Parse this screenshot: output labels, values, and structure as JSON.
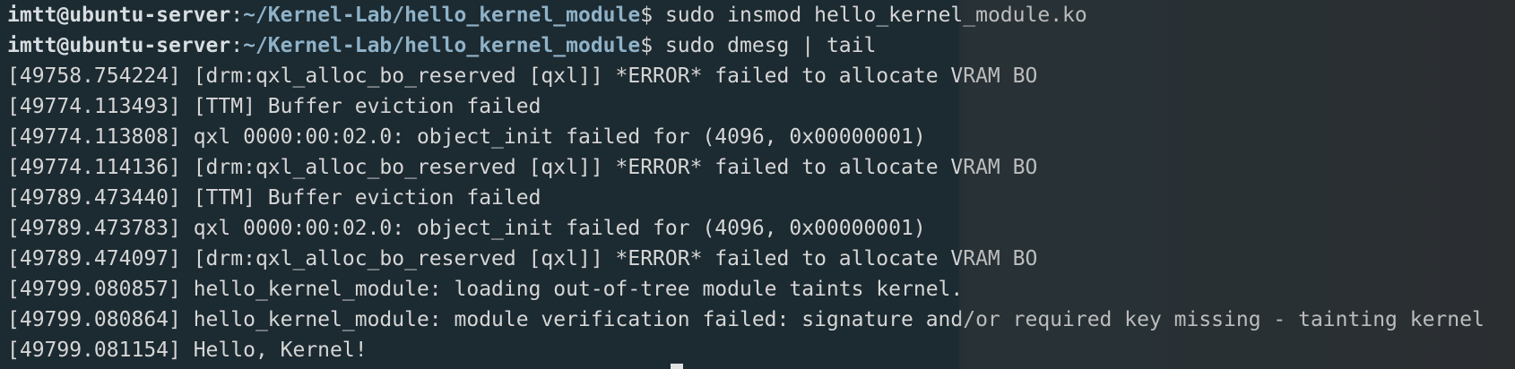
{
  "terminal": {
    "user_host": "imtt@ubuntu-server",
    "separator": ":",
    "cwd": "~/Kernel-Lab/hello_kernel_module",
    "prompt_char": "$",
    "commands": [
      "sudo insmod hello_kernel_module.ko",
      "sudo dmesg | tail"
    ],
    "output": [
      "[49758.754224] [drm:qxl_alloc_bo_reserved [qxl]] *ERROR* failed to allocate VRAM BO",
      "[49774.113493] [TTM] Buffer eviction failed",
      "[49774.113808] qxl 0000:00:02.0: object_init failed for (4096, 0x00000001)",
      "[49774.114136] [drm:qxl_alloc_bo_reserved [qxl]] *ERROR* failed to allocate VRAM BO",
      "[49789.473440] [TTM] Buffer eviction failed",
      "[49789.473783] qxl 0000:00:02.0: object_init failed for (4096, 0x00000001)",
      "[49789.474097] [drm:qxl_alloc_bo_reserved [qxl]] *ERROR* failed to allocate VRAM BO",
      "[49799.080857] hello_kernel_module: loading out-of-tree module taints kernel.",
      "[49799.080864] hello_kernel_module: module verification failed: signature and/or required key missing - tainting kernel",
      "[49799.081154] Hello, Kernel!"
    ]
  },
  "colors": {
    "background": "#1c2a31",
    "text": "#d6d6d6",
    "path": "#8fb2c8"
  }
}
